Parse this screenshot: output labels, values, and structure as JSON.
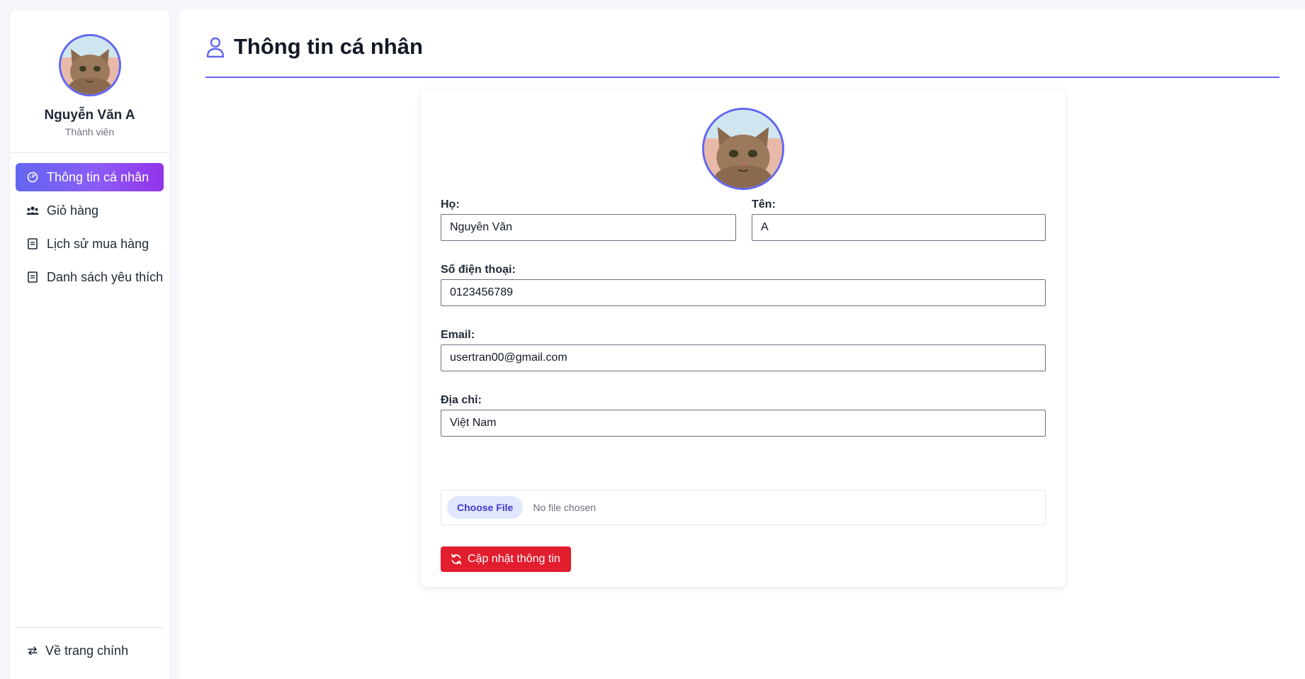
{
  "sidebar": {
    "user_name": "Nguyễn Văn A",
    "user_role": "Thành viên",
    "items": [
      {
        "label": "Thông tin cá nhân",
        "icon": "dashboard-icon",
        "active": true
      },
      {
        "label": "Giỏ hàng",
        "icon": "users-icon",
        "active": false
      },
      {
        "label": "Lịch sử mua hàng",
        "icon": "document-icon",
        "active": false
      },
      {
        "label": "Danh sách yêu thích",
        "icon": "document-icon",
        "active": false
      }
    ],
    "back_label": "Về trang chính"
  },
  "page": {
    "title": "Thông tin cá nhân",
    "title_icon": "user-icon"
  },
  "form": {
    "last_name_label": "Họ:",
    "last_name_value": "Nguyễn Văn",
    "first_name_label": "Tên:",
    "first_name_value": "A",
    "phone_label": "Số điện thoại:",
    "phone_value": "0123456789",
    "email_label": "Email:",
    "email_value": "usertran00@gmail.com",
    "address_label": "Địa chỉ:",
    "address_value": "Việt Nam",
    "file_button_label": "Choose File",
    "file_status": "No file chosen",
    "submit_label": "Cập nhật thông tin"
  },
  "colors": {
    "accent": "#6366f1",
    "active_gradient_end": "#9333ea",
    "submit": "#e11d2e",
    "file_button_bg": "#e0e7ff"
  }
}
